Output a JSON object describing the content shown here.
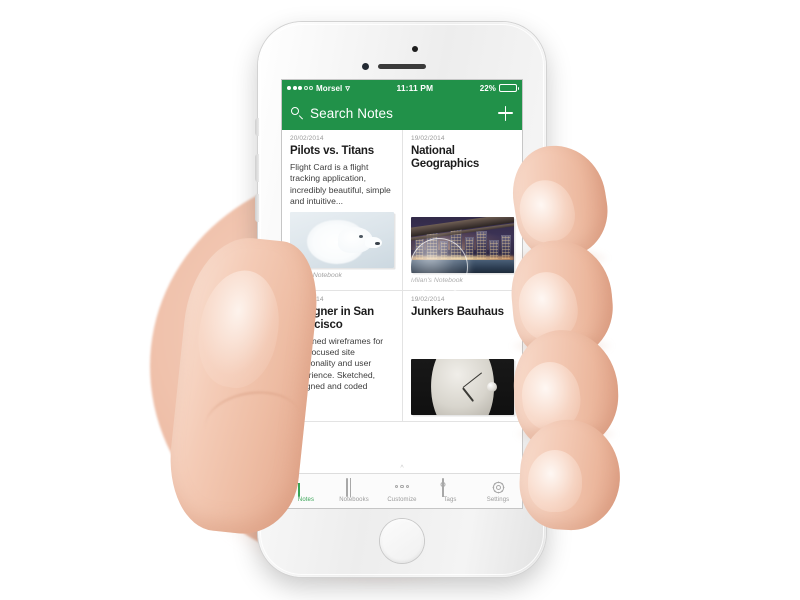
{
  "device": {
    "name": "smartphone-mockup",
    "body_color": "#f2f2f2"
  },
  "status_bar": {
    "signal_dots_filled": 3,
    "signal_dots_empty": 2,
    "carrier": "Morsel",
    "wifi_icon": "wifi-icon",
    "time": "11:11 PM",
    "battery_percent": "22%",
    "battery_level": 22
  },
  "nav_bar": {
    "search_icon": "search-icon",
    "search_placeholder": "Search Notes",
    "add_icon": "plus-icon",
    "accent_color": "#219149"
  },
  "notes": [
    {
      "date": "20/02/2014",
      "title": "Pilots vs. Titans",
      "body": "Flight Card is a flight tracking application, incredibly beautiful, simple and intuitive...",
      "image": "white-lion-photo",
      "notebook": "Milan's Notebook"
    },
    {
      "date": "19/02/2014",
      "title": "National Geographics",
      "body": "",
      "image": "night-cityscape-photo",
      "notebook": "Milan's Notebook"
    },
    {
      "date": "17/02/2014",
      "title": "Designer in San Francisco",
      "body": "Designed wireframes for user focused site functionality and user experience. Sketched, designed and coded",
      "image": "",
      "notebook": ""
    },
    {
      "date": "19/02/2014",
      "title": "Junkers Bauhaus",
      "body": "",
      "image": "wristwatch-photo",
      "notebook": ""
    }
  ],
  "tab_bar": {
    "active_color": "#3aa557",
    "inactive_color": "#9b9b9b",
    "items": [
      {
        "label": "Notes",
        "icon": "notes-document-icon",
        "active": true
      },
      {
        "label": "Notebooks",
        "icon": "notebook-icon",
        "active": false
      },
      {
        "label": "Customize",
        "icon": "three-dots-icon",
        "active": false
      },
      {
        "label": "Tags",
        "icon": "tag-icon",
        "active": false
      },
      {
        "label": "Settings",
        "icon": "gear-icon",
        "active": false
      }
    ]
  }
}
